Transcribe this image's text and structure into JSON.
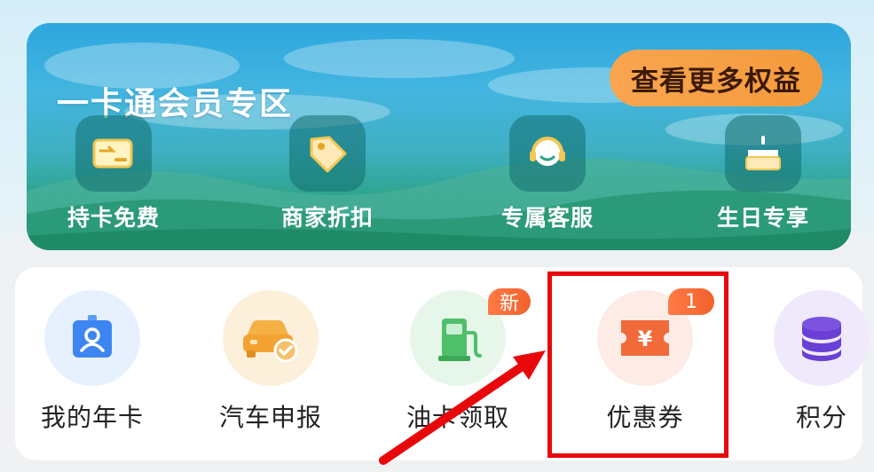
{
  "banner": {
    "title": "一卡通会员专区",
    "more_button": "查看更多权益",
    "perks": [
      {
        "label": "持卡免费",
        "icon": "card-icon"
      },
      {
        "label": "商家折扣",
        "icon": "tag-icon"
      },
      {
        "label": "专属客服",
        "icon": "headset-icon"
      },
      {
        "label": "生日专享",
        "icon": "cake-icon"
      }
    ]
  },
  "menu": {
    "items": [
      {
        "label": "我的年卡",
        "icon": "id-card-icon",
        "badge": ""
      },
      {
        "label": "汽车申报",
        "icon": "car-check-icon",
        "badge": ""
      },
      {
        "label": "油卡领取",
        "icon": "fuel-pump-icon",
        "badge": "新"
      },
      {
        "label": "优惠券",
        "icon": "coupon-icon",
        "badge": "1"
      },
      {
        "label": "积分",
        "icon": "coins-stack-icon",
        "badge": ""
      }
    ]
  },
  "colors": {
    "accent_orange": "#f49a3b",
    "badge": "#f0612d",
    "highlight": "#e8080b"
  }
}
